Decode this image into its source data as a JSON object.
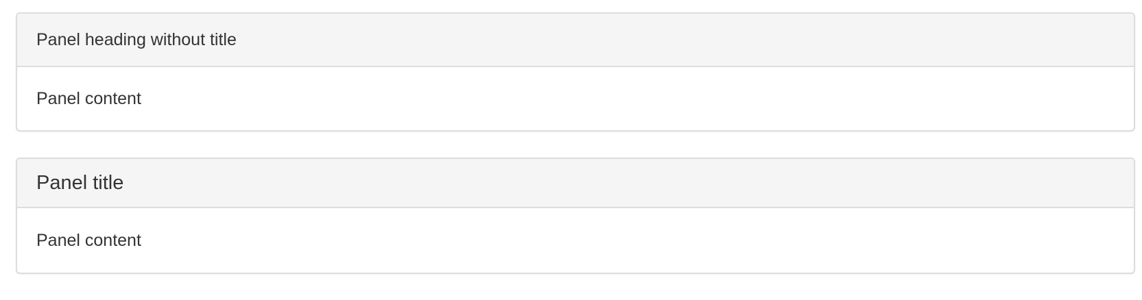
{
  "panels": [
    {
      "heading": "Panel heading without title",
      "content": "Panel content"
    },
    {
      "title": "Panel title",
      "content": "Panel content"
    }
  ]
}
